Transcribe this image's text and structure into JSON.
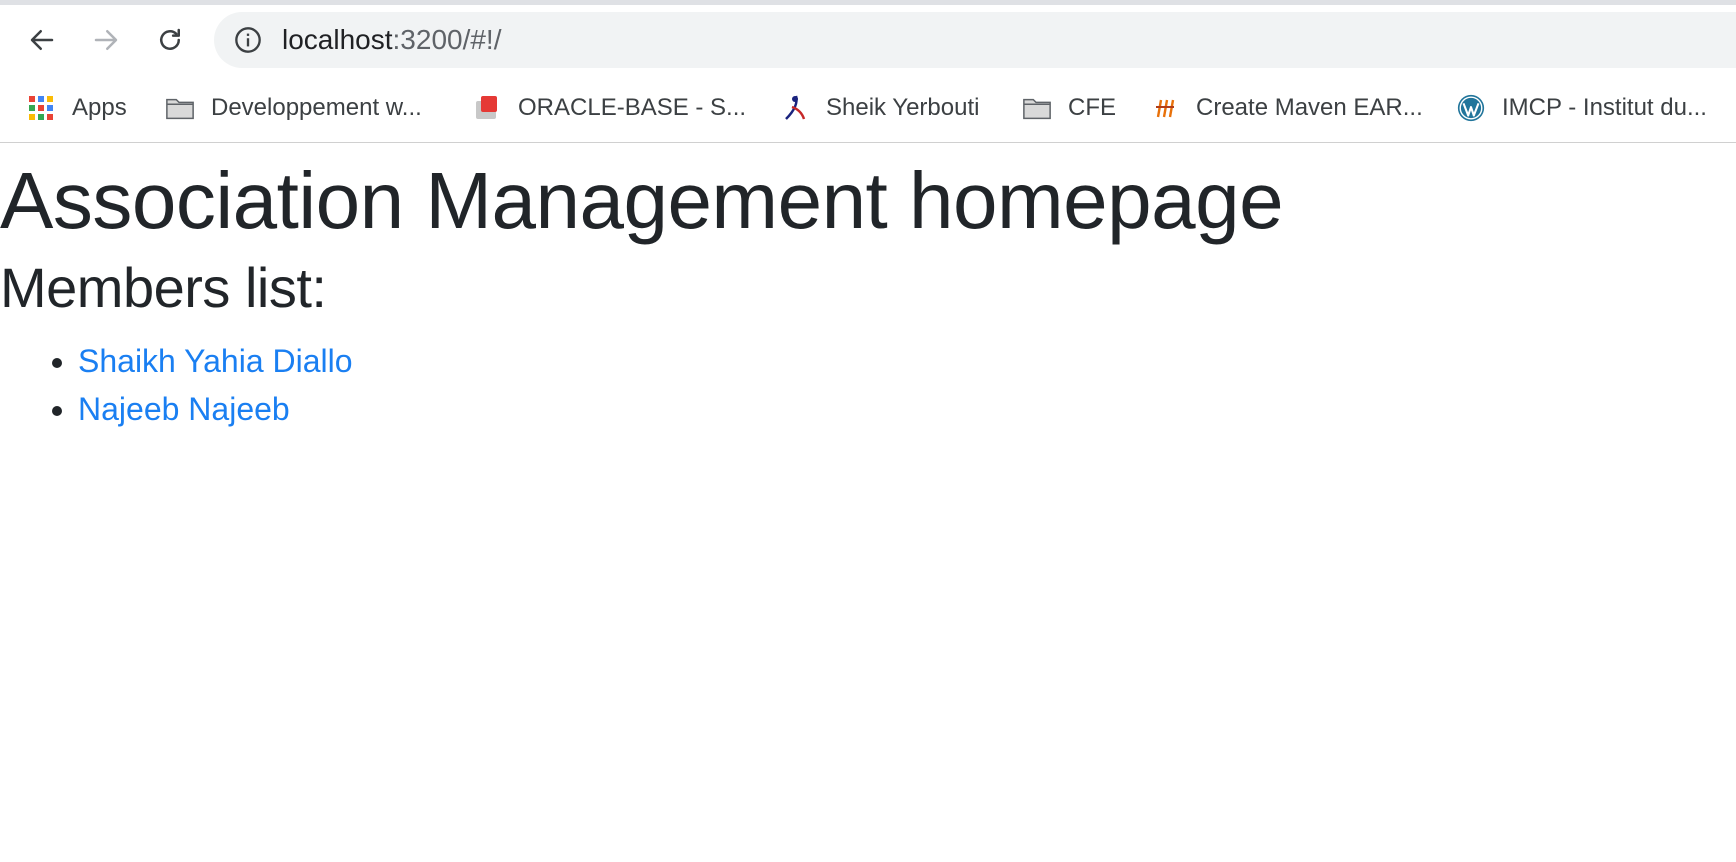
{
  "browser": {
    "url_host": "localhost",
    "url_rest": ":3200/#!/"
  },
  "bookmarks": [
    {
      "label": "Apps",
      "icon": "apps-grid-icon"
    },
    {
      "label": "Developpement w...",
      "icon": "folder-icon"
    },
    {
      "label": "ORACLE-BASE - S...",
      "icon": "oracle-base-icon"
    },
    {
      "label": "Sheik Yerbouti",
      "icon": "site-favicon-icon"
    },
    {
      "label": "CFE",
      "icon": "folder-icon"
    },
    {
      "label": "Create Maven EAR...",
      "icon": "site-favicon-icon"
    },
    {
      "label": "IMCP - Institut du...",
      "icon": "wordpress-icon"
    }
  ],
  "page": {
    "title": "Association Management homepage",
    "subtitle": "Members list:",
    "members": [
      {
        "name": "Shaikh Yahia Diallo"
      },
      {
        "name": "Najeeb Najeeb"
      }
    ]
  },
  "colors": {
    "link": "#1a7ff2",
    "text": "#212529",
    "omnibox_bg": "#f1f3f4"
  }
}
